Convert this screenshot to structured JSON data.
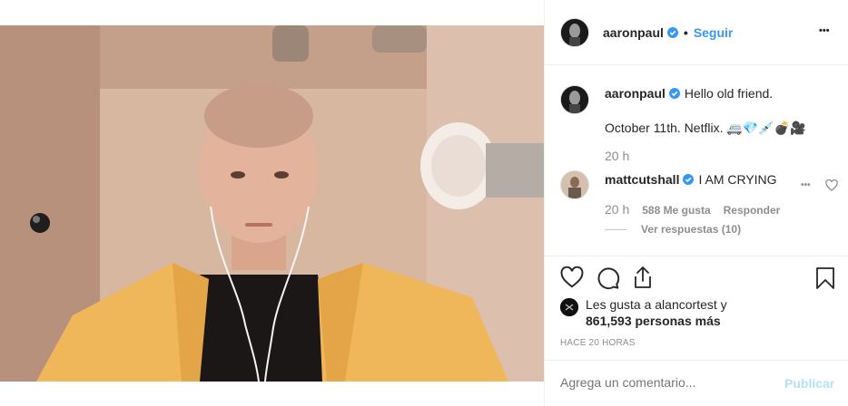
{
  "post": {
    "author": "aaronpaul",
    "follow_label": "Seguir",
    "header_dot": "•",
    "more_options": "•••"
  },
  "caption": {
    "username": "aaronpaul",
    "line1": "Hello old friend.",
    "line2": "October 11th. Netflix. 🚐💎💉💣🎥",
    "time": "20 h"
  },
  "comment": {
    "username": "mattcutshall",
    "text": "I AM CRYING",
    "time": "20 h",
    "likes": "588 Me gusta",
    "reply_label": "Responder",
    "view_replies": "Ver respuestas (10)",
    "more": "•••"
  },
  "likes": {
    "line1": "Les gusta a alancortest y",
    "line2": "861,593 personas más"
  },
  "timestamp": "HACE 20 HORAS",
  "add_comment": {
    "placeholder": "Agrega un comentario...",
    "publish_label": "Publicar"
  },
  "colors": {
    "link": "#3897f0",
    "publish_disabled": "#b2dffc",
    "verified": "#3897f0",
    "hoodie": "#f0b75a"
  }
}
